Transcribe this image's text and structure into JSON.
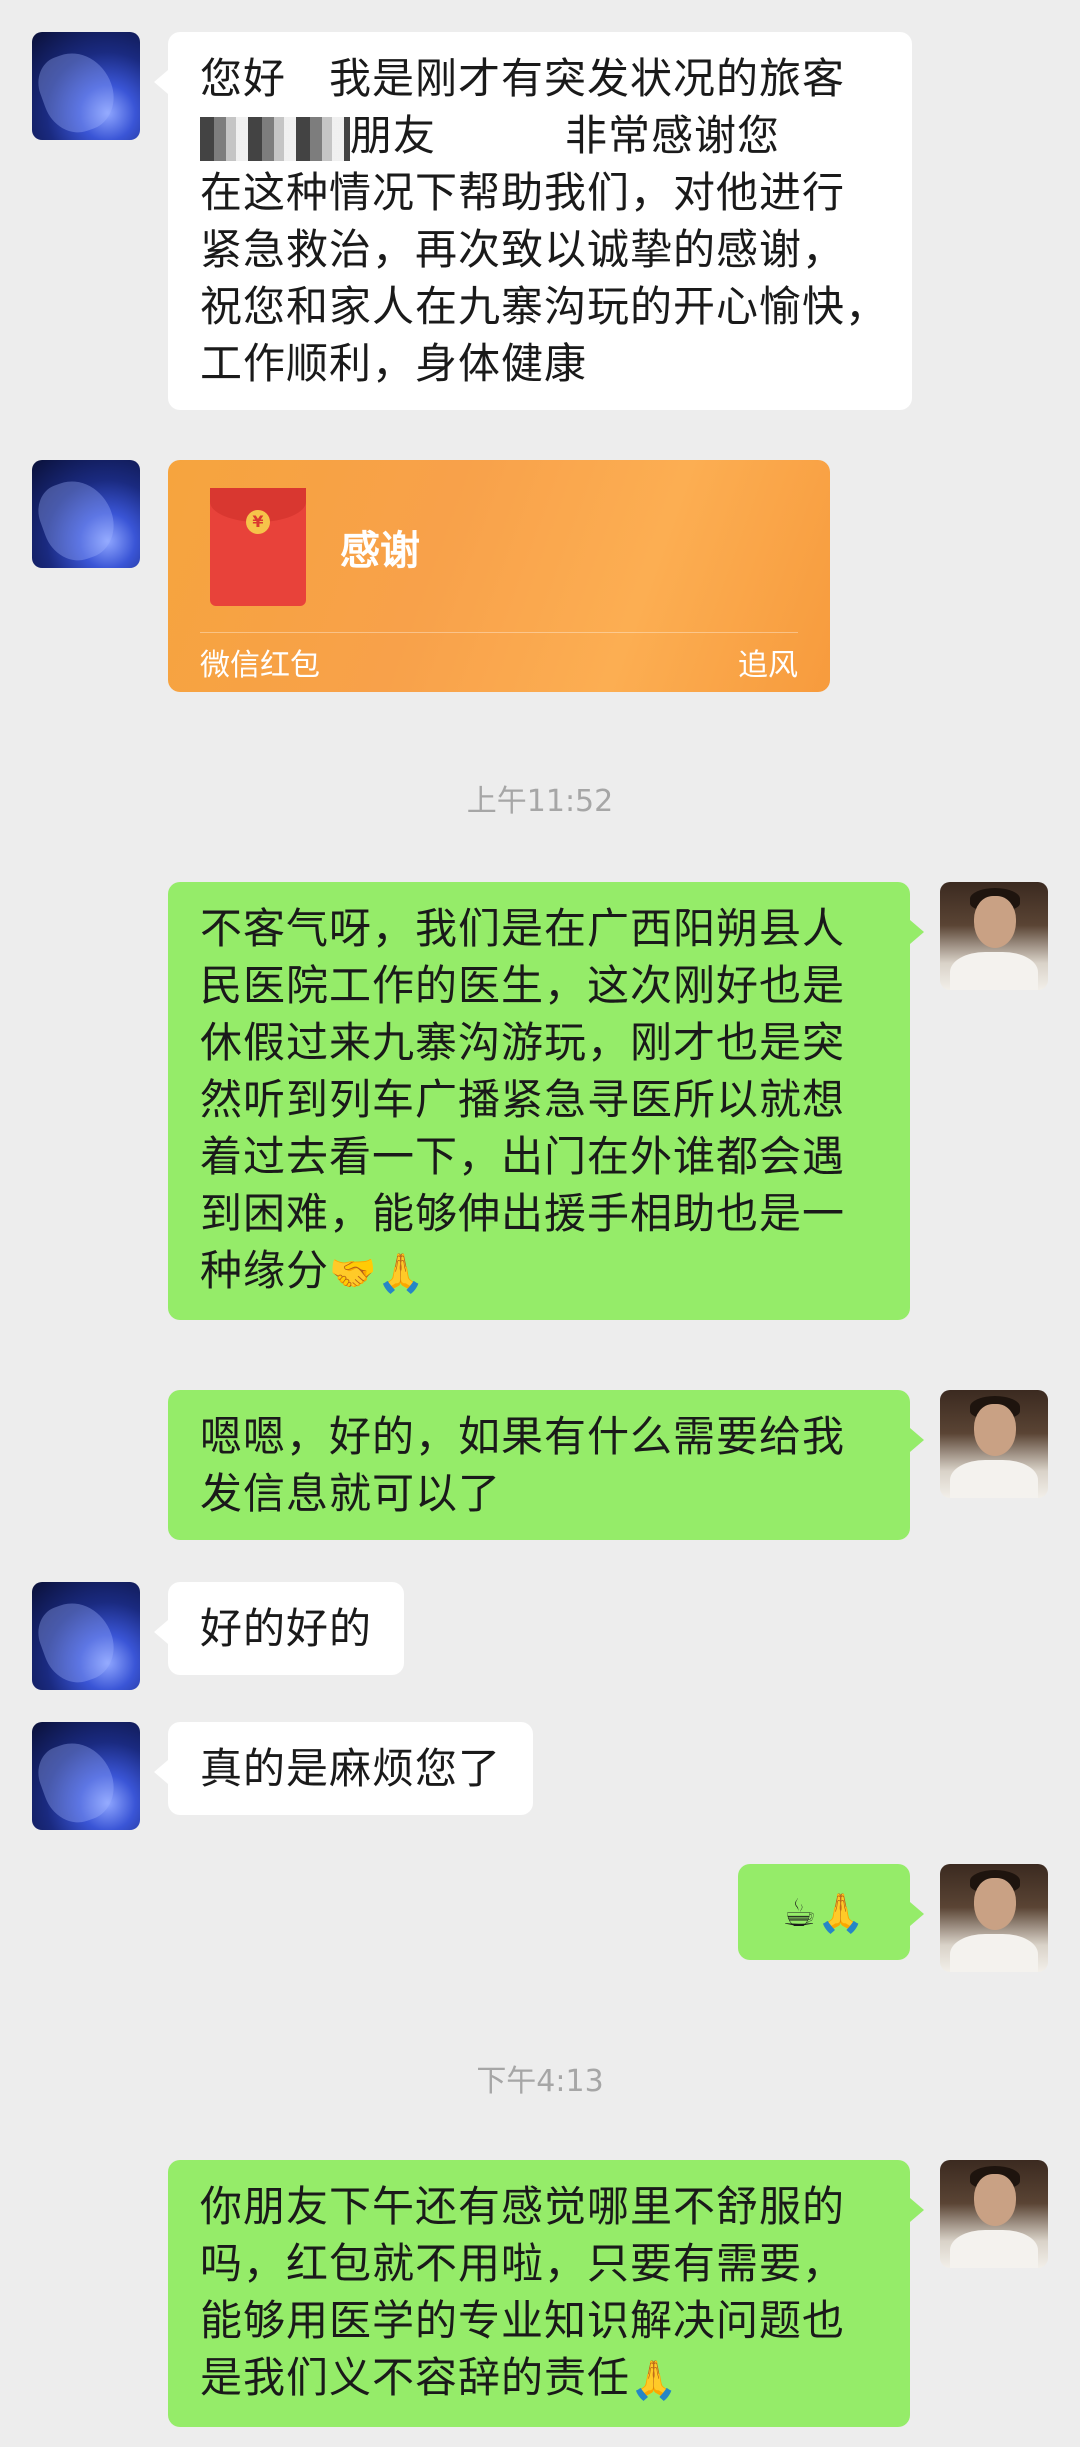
{
  "messages": {
    "m1": {
      "sender": "other",
      "lines": [
        "您好　我是刚才有突发状况的旅客",
        "朋友　　　非常感谢您",
        "在这种情况下帮助我们，对他进行",
        "紧急救治，再次致以诚挚的感谢，",
        "祝您和家人在九寨沟玩的开心愉快，",
        "工作顺利，身体健康"
      ]
    },
    "red_packet": {
      "sender": "other",
      "title": "感谢",
      "label": "微信红包",
      "from": "追风",
      "coin_symbol": "¥"
    },
    "time1": "上午11:52",
    "m2": {
      "sender": "me",
      "lines": [
        "不客气呀，我们是在广西阳朔县人",
        "民医院工作的医生，这次刚好也是",
        "休假过来九寨沟游玩，刚才也是突",
        "然听到列车广播紧急寻医所以就想",
        "着过去看一下，出门在外谁都会遇",
        "到困难，能够伸出援手相助也是一",
        "种缘分"
      ],
      "emojis": "🤝🙏"
    },
    "m3": {
      "sender": "me",
      "lines": [
        "嗯嗯，好的，如果有什么需要给我",
        "发信息就可以了"
      ]
    },
    "m4": {
      "sender": "other",
      "text": "好的好的"
    },
    "m5": {
      "sender": "other",
      "text": "真的是麻烦您了"
    },
    "m6": {
      "sender": "me",
      "emojis": "☕🙏"
    },
    "time2": "下午4:13",
    "m7": {
      "sender": "me",
      "lines": [
        "你朋友下午还有感觉哪里不舒服的",
        "吗，红包就不用啦，只要有需要，",
        "能够用医学的专业知识解决问题也",
        "是我们义不容辞的责任"
      ],
      "emojis": "🙏"
    }
  }
}
